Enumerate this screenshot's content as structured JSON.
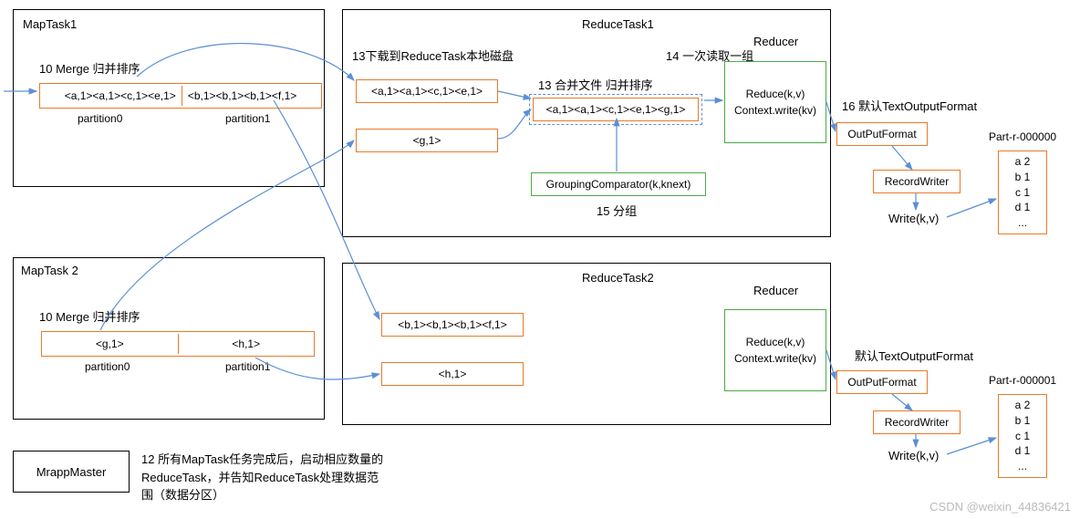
{
  "maptask1": {
    "title": "MapTask1",
    "merge_label": "10 Merge 归并排序",
    "part0": "<a,1><a,1><c,1><e,1>",
    "part1": "<b,1><b,1><b,1><f,1>",
    "p0lbl": "partition0",
    "p1lbl": "partition1"
  },
  "maptask2": {
    "title": "MapTask 2",
    "merge_label": "10 Merge 归并排序",
    "part0": "<g,1>",
    "part1": "<h,1>",
    "p0lbl": "partition0",
    "p1lbl": "partition1"
  },
  "reducetask1": {
    "title": "ReduceTask1",
    "download_label": "13下载到ReduceTask本地磁盘",
    "merge_label": "13 合并文件 归并排序",
    "read_label": "14 一次读取一组",
    "box_a": "<a,1><a,1><c,1><e,1>",
    "box_g": "<g,1>",
    "combined": "<a,1><a,1><c,1><e,1><g,1>",
    "grouping": "GroupingComparator(k,knext)",
    "group_label": "15 分组",
    "reducer_title": "Reducer",
    "reduce_l1": "Reduce(k,v)",
    "reduce_l2": "Context.write(kv)",
    "out_format_label": "16 默认TextOutputFormat",
    "out_format": "OutPutFormat",
    "record_writer": "RecordWriter",
    "write": "Write(k,v)",
    "part_title": "Part-r-000000",
    "out_l1": "a 2",
    "out_l2": "b 1",
    "out_l3": "c 1",
    "out_l4": "d 1",
    "out_l5": "..."
  },
  "reducetask2": {
    "title": "ReduceTask2",
    "box_b": "<b,1><b,1><b,1><f,1>",
    "box_h": "<h,1>",
    "reducer_title": "Reducer",
    "reduce_l1": "Reduce(k,v)",
    "reduce_l2": "Context.write(kv)",
    "out_format_label": "默认TextOutputFormat",
    "out_format": "OutPutFormat",
    "record_writer": "RecordWriter",
    "write": "Write(k,v)",
    "part_title": "Part-r-000001",
    "out_l1": "a 2",
    "out_l2": "b 1",
    "out_l3": "c 1",
    "out_l4": "d 1",
    "out_l5": "..."
  },
  "mrapp": {
    "title": "MrappMaster",
    "desc": "12 所有MapTask任务完成后，启动相应数量的ReduceTask，并告知ReduceTask处理数据范围（数据分区）"
  },
  "watermark": "CSDN @weixin_44836421"
}
